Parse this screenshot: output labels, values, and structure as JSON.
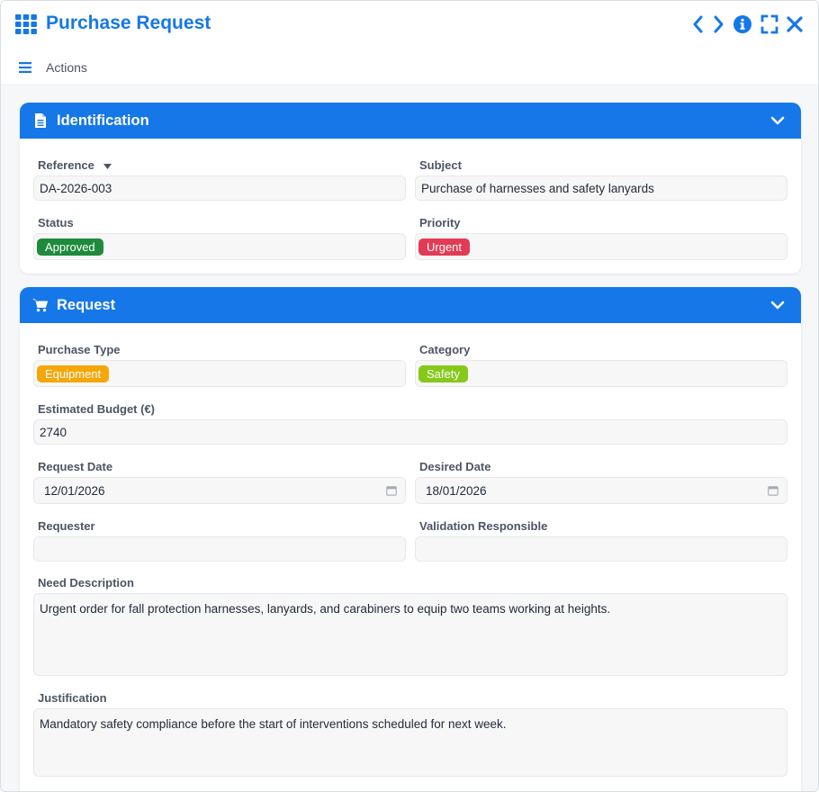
{
  "window": {
    "title": "Purchase Request",
    "actions_label": "Actions",
    "brand_color": "#1677e8",
    "icons": [
      "grid-icon",
      "chevron-left-icon",
      "chevron-right-icon",
      "info-icon",
      "fullscreen-icon",
      "close-icon",
      "menu-icon"
    ]
  },
  "identification": {
    "title": "Identification",
    "icon": "document-icon",
    "reference_label": "Reference",
    "reference_value": "DA-2026-003",
    "subject_label": "Subject",
    "subject_value": "Purchase of harnesses and safety lanyards",
    "status_label": "Status",
    "status_value": "Approved",
    "status_color": "#1e8a3c",
    "priority_label": "Priority",
    "priority_value": "Urgent",
    "priority_color": "#e23b55"
  },
  "request": {
    "title": "Request",
    "icon": "cart-icon",
    "purchase_type_label": "Purchase Type",
    "purchase_type_value": "Equipment",
    "purchase_type_color": "#f5a70a",
    "category_label": "Category",
    "category_value": "Safety",
    "category_color": "#86c91a",
    "budget_label": "Estimated Budget (€)",
    "budget_value": "2740",
    "request_date_label": "Request Date",
    "request_date_value": "12/01/2026",
    "desired_date_label": "Desired Date",
    "desired_date_value": "18/01/2026",
    "requester_label": "Requester",
    "requester_value": "",
    "validation_label": "Validation Responsible",
    "validation_value": "",
    "need_label": "Need Description",
    "need_value": "Urgent order for fall protection harnesses, lanyards, and carabiners to equip two teams working at heights.",
    "justification_label": "Justification",
    "justification_value": "Mandatory safety compliance before the start of interventions scheduled for next week."
  }
}
